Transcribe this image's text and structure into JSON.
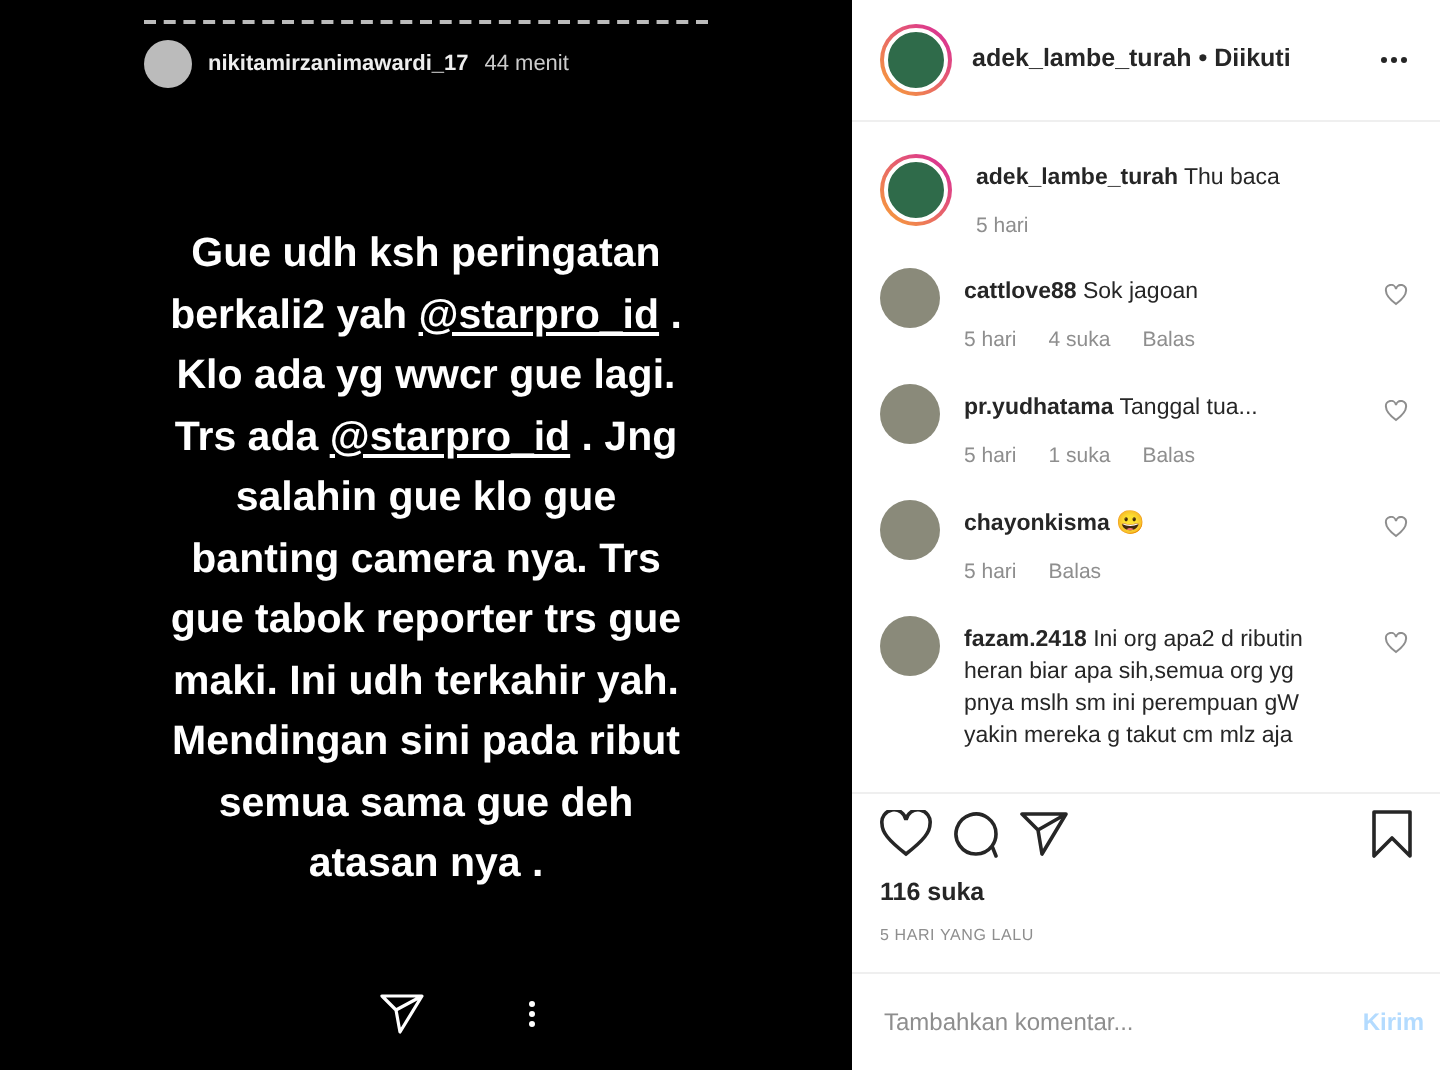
{
  "story": {
    "username": "nikitamirzanimawardi_17",
    "time": "44 menit",
    "text": [
      {
        "kind": "plain",
        "text": "Gue udh ksh peringatan berkali2 yah "
      },
      {
        "kind": "mention",
        "text": "@starpro_id"
      },
      {
        "kind": "plain",
        "text": " . Klo ada yg wwcr gue lagi. Trs ada "
      },
      {
        "kind": "mention",
        "text": "@starpro_id"
      },
      {
        "kind": "plain",
        "text": " . Jng salahin gue klo gue banting camera nya. Trs gue tabok reporter trs gue maki. Ini udh terkahir yah. Mendingan sini pada ribut semua sama gue deh atasan nya ."
      }
    ]
  },
  "post": {
    "username": "adek_lambe_turah",
    "separator": "•",
    "follow": "Diikuti",
    "comments": [
      {
        "kind": "caption",
        "user": "adek_lambe_turah",
        "text": "Thu baca",
        "time": "5 hari"
      },
      {
        "kind": "comment",
        "user": "cattlove88",
        "text": "Sok jagoan",
        "time": "5 hari",
        "likes": "4 suka",
        "reply": "Balas"
      },
      {
        "kind": "comment",
        "user": "pr.yudhatama",
        "text": "Tanggal tua...",
        "time": "5 hari",
        "likes": "1 suka",
        "reply": "Balas"
      },
      {
        "kind": "comment",
        "user": "chayonkisma",
        "text": "😀",
        "time": "5 hari",
        "reply": "Balas"
      },
      {
        "kind": "comment",
        "user": "fazam.2418",
        "text": "Ini org apa2 d ributin heran biar apa sih,semua org yg pnya mslh sm ini perempuan gW yakin mereka g takut cm mlz aja"
      }
    ],
    "likes": "116 suka",
    "date": "5 HARI YANG LALU",
    "placeholder": "Tambahkan komentar...",
    "send": "Kirim"
  }
}
